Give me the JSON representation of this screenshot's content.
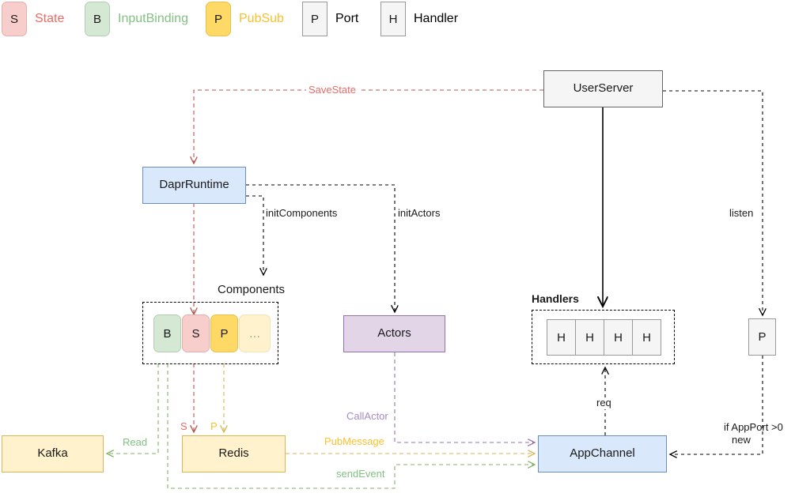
{
  "legend": {
    "items": [
      {
        "glyph": "S",
        "label": "State",
        "fill": "#f8cecc",
        "stroke": "#e3b0ae",
        "text_color": "#ea6b66",
        "shape": "rounded"
      },
      {
        "glyph": "B",
        "label": "InputBinding",
        "fill": "#d5e8d4",
        "stroke": "#b2ceb1",
        "text_color": "#82c182",
        "shape": "rounded"
      },
      {
        "glyph": "P",
        "label": "PubSub",
        "fill": "#ffd966",
        "stroke": "#e6c34f",
        "text_color": "#fbc02d",
        "shape": "rounded"
      },
      {
        "glyph": "P",
        "label": "Port",
        "fill": "#f5f5f5",
        "stroke": "#999999",
        "text_color": "#1a1a1a",
        "shape": "square"
      },
      {
        "glyph": "H",
        "label": "Handler",
        "fill": "#f5f5f5",
        "stroke": "#999999",
        "text_color": "#1a1a1a",
        "shape": "square"
      }
    ]
  },
  "nodes": {
    "user_server": "UserServer",
    "dapr_runtime": "DaprRuntime",
    "components_title": "Components",
    "actors": "Actors",
    "handlers_title": "Handlers",
    "kafka": "Kafka",
    "redis": "Redis",
    "app_channel": "AppChannel",
    "port": "P",
    "components": [
      {
        "glyph": "B",
        "kind": "bind"
      },
      {
        "glyph": "S",
        "kind": "st"
      },
      {
        "glyph": "P",
        "kind": "pub"
      },
      {
        "glyph": "…",
        "kind": "more"
      }
    ],
    "handlers": [
      {
        "glyph": "H"
      },
      {
        "glyph": "H"
      },
      {
        "glyph": "H"
      },
      {
        "glyph": "H"
      }
    ]
  },
  "edge_labels": {
    "save_state": "SaveState",
    "init_components": "initComponents",
    "init_actors": "initActors",
    "listen": "listen",
    "req": "req",
    "if_app_port_line1": "if AppPort >0",
    "if_app_port_line2": "new",
    "read": "Read",
    "call_actor": "CallActor",
    "pub_message": "PubMessage",
    "send_event": "sendEvent",
    "s_marker": "S",
    "p_marker": "P"
  },
  "colors": {
    "state_red": "#b85450",
    "state_text": "#ea6b66",
    "binding_green": "#82b366",
    "binding_text": "#82c182",
    "pubsub_yellow": "#d6b656",
    "pubsub_text": "#fbc02d",
    "actor_purple": "#9673a6",
    "actor_text": "#a48bc0",
    "black": "#000000",
    "proc_fill": "#dae8fc",
    "proc_stroke": "#6c8ebf",
    "store_fill": "#fff2cc",
    "store_stroke": "#d6b656",
    "actors_fill": "#e1d5e7",
    "plain_fill": "#f5f5f5",
    "plain_stroke": "#666666"
  }
}
